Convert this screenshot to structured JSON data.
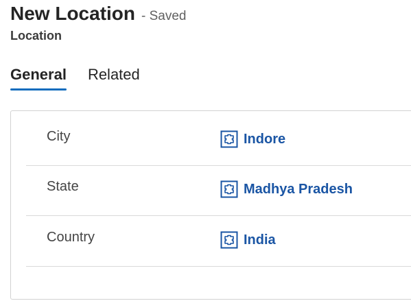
{
  "header": {
    "title": "New Location",
    "saved_status": "- Saved",
    "entity_label": "Location"
  },
  "tabs": [
    {
      "label": "General",
      "active": true
    },
    {
      "label": "Related",
      "active": false
    }
  ],
  "fields": [
    {
      "label": "City",
      "value": "Indore",
      "icon": "lookup-record-icon"
    },
    {
      "label": "State",
      "value": "Madhya Pradesh",
      "icon": "lookup-record-icon"
    },
    {
      "label": "Country",
      "value": "India",
      "icon": "lookup-record-icon"
    }
  ],
  "colors": {
    "accent": "#0f6cbd",
    "link": "#1a55a4"
  }
}
